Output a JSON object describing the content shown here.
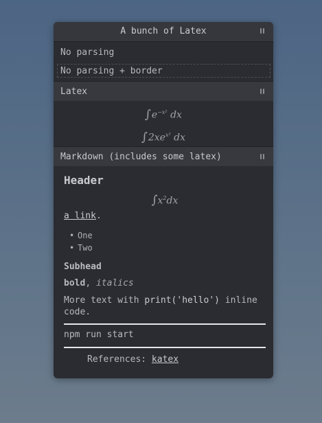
{
  "panel": {
    "title": "A bunch of Latex",
    "rows": {
      "no_parsing": "No parsing",
      "no_parsing_border": "No parsing + border"
    }
  },
  "sections": {
    "latex": {
      "label": "Latex",
      "eq1": {
        "integral": "∫",
        "base": "e",
        "exp": "−x²",
        "tail": "dx"
      },
      "eq2": {
        "integral": "∫",
        "base": "2xe",
        "exp": "x²",
        "tail": "dx"
      }
    },
    "markdown": {
      "label": "Markdown (includes some latex)",
      "header": "Header",
      "eq": {
        "integral": "∫",
        "base": "x",
        "exp": "2",
        "tail": "dx"
      },
      "link_text": "a link",
      "link_suffix": ".",
      "list": [
        "One",
        "Two"
      ],
      "subhead": "Subhead",
      "bold": "bold",
      "comma": ", ",
      "italics": "italics",
      "para_prefix": "More text with ",
      "code_inline": "print('hello')",
      "para_suffix": " inline code.",
      "code_block": "npm run start",
      "refs_prefix": "References: ",
      "refs_link": "katex"
    }
  }
}
